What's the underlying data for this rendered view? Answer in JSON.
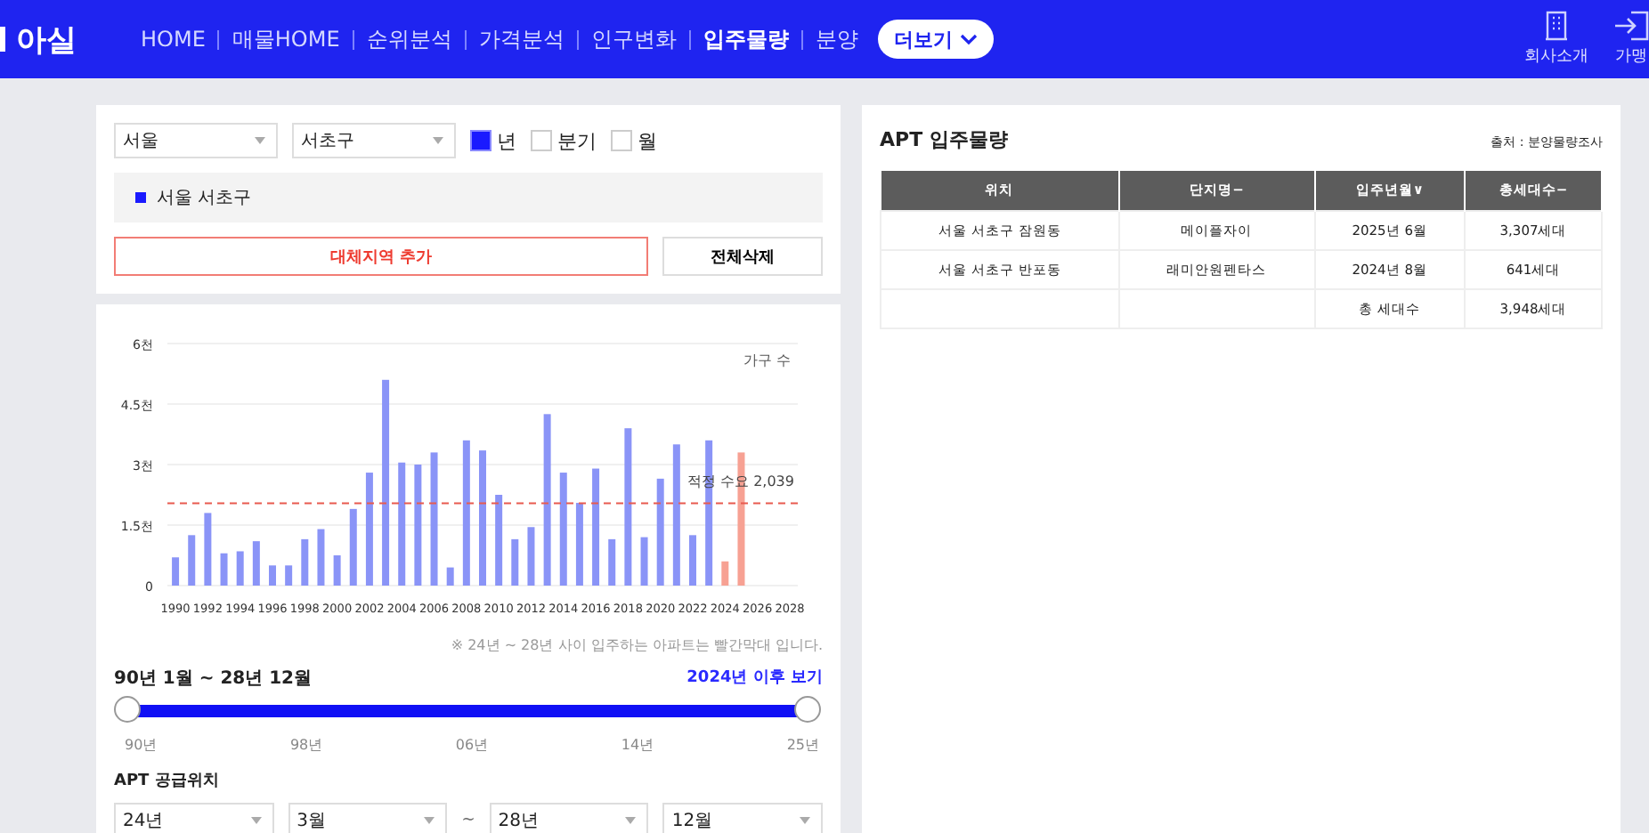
{
  "header": {
    "logo": "아실",
    "nav": [
      {
        "label": "HOME",
        "selected": false
      },
      {
        "label": "매물HOME",
        "selected": false
      },
      {
        "label": "순위분석",
        "selected": false
      },
      {
        "label": "가격분석",
        "selected": false
      },
      {
        "label": "인구변화",
        "selected": false
      },
      {
        "label": "입주물량",
        "selected": true
      },
      {
        "label": "분양",
        "selected": false
      }
    ],
    "more_button": "더보기",
    "right_links": [
      {
        "kind": "building",
        "label": "회사소개"
      },
      {
        "kind": "login",
        "label": "가맹"
      }
    ]
  },
  "filters": {
    "city": "서울",
    "district": "서초구",
    "periods": [
      {
        "label": "년",
        "checked": true
      },
      {
        "label": "분기",
        "checked": false
      },
      {
        "label": "월",
        "checked": false
      }
    ],
    "regions": [
      {
        "label": "서울 서초구",
        "color": "#1a1aff"
      }
    ],
    "add_button": "대체지역 추가",
    "clear_button": "전체삭제"
  },
  "chart": {
    "note": "※ 24년 ~ 28년 사이 입주하는 아파트는 빨간막대 입니다.",
    "chart_data": {
      "type": "bar",
      "categories": [
        "1990",
        null,
        "1992",
        null,
        "1994",
        null,
        "1996",
        null,
        "1998",
        null,
        "2000",
        null,
        "2002",
        null,
        "2004",
        null,
        "2006",
        null,
        "2008",
        null,
        "2010",
        null,
        "2012",
        null,
        "2014",
        null,
        "2016",
        null,
        "2018",
        null,
        "2020",
        null,
        "2022",
        null,
        "2024",
        null,
        "2026",
        null,
        "2028"
      ],
      "series": [
        {
          "color": "#8a94f7",
          "values": [
            0.7,
            1.25,
            1.8,
            0.8,
            0.85,
            1.1,
            0.5,
            0.5,
            1.15,
            1.4,
            0.75,
            1.9,
            2.8,
            5.1,
            3.05,
            3.0,
            3.3,
            0.45,
            3.6,
            3.35,
            2.25,
            1.15,
            1.45,
            4.25,
            2.8,
            2.05,
            2.9,
            1.15,
            3.9,
            1.2,
            2.65,
            3.5,
            1.25,
            3.6,
            null,
            null,
            null,
            null,
            null
          ]
        },
        {
          "color": "#f7a193",
          "values": [
            null,
            null,
            null,
            null,
            null,
            null,
            null,
            null,
            null,
            null,
            null,
            null,
            null,
            null,
            null,
            null,
            null,
            null,
            null,
            null,
            null,
            null,
            null,
            null,
            null,
            null,
            null,
            null,
            null,
            null,
            null,
            null,
            null,
            null,
            0.6,
            3.3,
            null,
            null,
            null
          ]
        }
      ],
      "ylabel": "가구 수",
      "grid": true,
      "ylim": [
        0,
        6
      ],
      "yticks": [
        {
          "value": 0,
          "label": "0"
        },
        {
          "value": 1.5,
          "label": "1.5천"
        },
        {
          "value": 3,
          "label": "3천"
        },
        {
          "value": 4.5,
          "label": "4.5천"
        },
        {
          "value": 6,
          "label": "6천"
        }
      ],
      "ref_lines": [
        {
          "axis": "y",
          "value": 2.039,
          "label": "적정 수요 2,039"
        }
      ]
    }
  },
  "range": {
    "title": "90년 1월 ~ 28년 12월",
    "link": "2024년 이후 보기",
    "handles": [
      {
        "level": 0
      },
      {
        "level": 1
      }
    ],
    "ticks": [
      "90년",
      "98년",
      "06년",
      "14년",
      "25년"
    ]
  },
  "supply": {
    "title": "APT 공급위치",
    "selects": [
      "24년",
      "3월",
      "28년",
      "12월"
    ],
    "separator": "~"
  },
  "table": {
    "title": "APT 입주물량",
    "source": "출처 : 분양물량조사",
    "columns": [
      {
        "label": "위치"
      },
      {
        "label": "단지명",
        "sort": "−"
      },
      {
        "label": "입주년월",
        "sort": "∨"
      },
      {
        "label": "총세대수",
        "sort": "−"
      }
    ],
    "rows": [
      [
        "서울 서초구 잠원동",
        "메이플자이",
        "2025년 6월",
        "3,307세대"
      ],
      [
        "서울 서초구 반포동",
        "래미안원펜타스",
        "2024년 8월",
        "641세대"
      ],
      [
        "",
        "",
        "총 세대수",
        "3,948세대"
      ]
    ]
  }
}
